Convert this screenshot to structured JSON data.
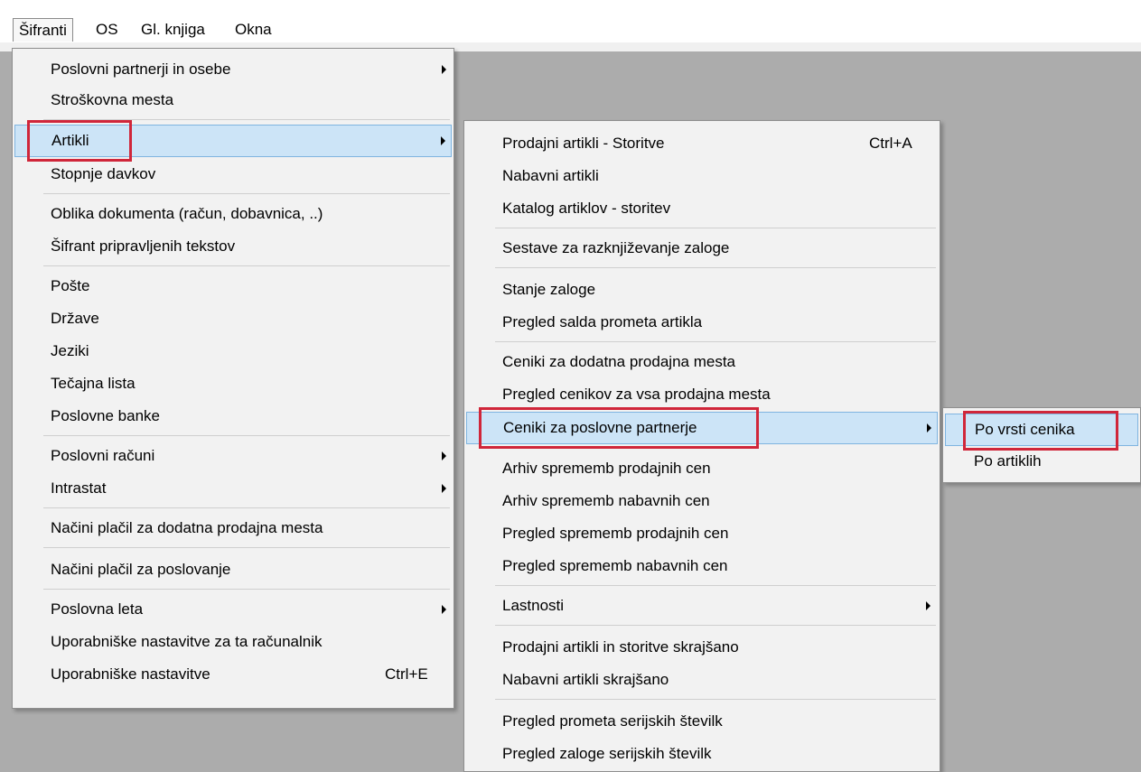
{
  "menubar": {
    "items": [
      {
        "label": "Šifranti"
      },
      {
        "label": "OS"
      },
      {
        "label": "Gl. knjiga"
      },
      {
        "label": "Okna"
      }
    ]
  },
  "menu1": {
    "items": [
      {
        "label": "Poslovni partnerji in osebe"
      },
      {
        "label": "Stroškovna mesta"
      },
      {
        "label": "Artikli"
      },
      {
        "label": "Stopnje davkov"
      },
      {
        "label": "Oblika dokumenta (račun, dobavnica, ..)"
      },
      {
        "label": "Šifrant pripravljenih tekstov"
      },
      {
        "label": "Pošte"
      },
      {
        "label": "Države"
      },
      {
        "label": "Jeziki"
      },
      {
        "label": "Tečajna lista"
      },
      {
        "label": "Poslovne banke"
      },
      {
        "label": "Poslovni računi"
      },
      {
        "label": "Intrastat"
      },
      {
        "label": "Načini plačil za dodatna prodajna mesta"
      },
      {
        "label": "Načini plačil za poslovanje"
      },
      {
        "label": "Poslovna leta"
      },
      {
        "label": "Uporabniške nastavitve za ta računalnik"
      },
      {
        "label": "Uporabniške nastavitve",
        "shortcut": "Ctrl+E"
      }
    ]
  },
  "menu2": {
    "items": [
      {
        "label": "Prodajni artikli - Storitve",
        "shortcut": "Ctrl+A"
      },
      {
        "label": "Nabavni artikli"
      },
      {
        "label": "Katalog artiklov - storitev"
      },
      {
        "label": "Sestave za razknjiževanje zaloge"
      },
      {
        "label": "Stanje zaloge"
      },
      {
        "label": "Pregled salda prometa artikla"
      },
      {
        "label": "Ceniki za dodatna prodajna mesta"
      },
      {
        "label": "Pregled cenikov za vsa prodajna mesta"
      },
      {
        "label": "Ceniki za poslovne partnerje"
      },
      {
        "label": "Arhiv sprememb prodajnih cen"
      },
      {
        "label": "Arhiv sprememb nabavnih cen"
      },
      {
        "label": "Pregled sprememb prodajnih cen"
      },
      {
        "label": "Pregled sprememb nabavnih cen"
      },
      {
        "label": "Lastnosti"
      },
      {
        "label": "Prodajni artikli in storitve skrajšano"
      },
      {
        "label": "Nabavni artikli skrajšano"
      },
      {
        "label": "Pregled prometa serijskih številk"
      },
      {
        "label": "Pregled zaloge serijskih številk"
      }
    ]
  },
  "menu3": {
    "items": [
      {
        "label": "Po vrsti cenika"
      },
      {
        "label": "Po artiklih"
      }
    ]
  },
  "colors": {
    "highlight": "#cce4f7",
    "annotation": "#d0263a",
    "workspace": "#acacac"
  }
}
